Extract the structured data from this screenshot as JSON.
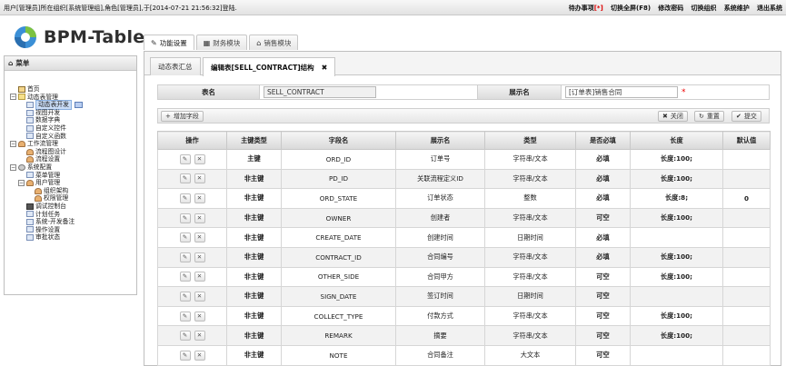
{
  "topbar": {
    "login_text": "用户[管理员]所在组织[系统管理组],角色[管理员],于[2014-07-21 21:56:32]登陆.",
    "todo_label": "待办事项",
    "todo_count_bracket": "[*]",
    "links": [
      "切换全屏(F8)",
      "修改密码",
      "切换组织",
      "系统维护",
      "退出系统"
    ]
  },
  "logo": {
    "text": "BPM-Table"
  },
  "module_tabs": [
    {
      "icon": "wrench-icon",
      "label": "功能设置",
      "active": true
    },
    {
      "icon": "grid-icon",
      "label": "财务模块",
      "active": false
    },
    {
      "icon": "home-icon",
      "label": "销售模块",
      "active": false
    }
  ],
  "sidebar": {
    "title": "菜单",
    "tree": [
      {
        "label": "首页",
        "level": 0,
        "icon": "home",
        "toggle": ""
      },
      {
        "label": "动态表管理",
        "level": 0,
        "icon": "folder",
        "toggle": "−"
      },
      {
        "label": "动态表开发",
        "level": 1,
        "icon": "doc",
        "toggle": "",
        "selected": true
      },
      {
        "label": "视图开发",
        "level": 1,
        "icon": "doc",
        "toggle": ""
      },
      {
        "label": "数据字典",
        "level": 1,
        "icon": "doc",
        "toggle": ""
      },
      {
        "label": "自定义控件",
        "level": 1,
        "icon": "doc",
        "toggle": ""
      },
      {
        "label": "自定义函数",
        "level": 1,
        "icon": "doc",
        "toggle": ""
      },
      {
        "label": "工作流管理",
        "level": 0,
        "icon": "people",
        "toggle": "−"
      },
      {
        "label": "流程图设计",
        "level": 1,
        "icon": "people",
        "toggle": ""
      },
      {
        "label": "流程设置",
        "level": 1,
        "icon": "people",
        "toggle": ""
      },
      {
        "label": "系统配置",
        "level": 0,
        "icon": "gear",
        "toggle": "−"
      },
      {
        "label": "菜单管理",
        "level": 1,
        "icon": "doc",
        "toggle": ""
      },
      {
        "label": "用户管理",
        "level": 1,
        "icon": "people",
        "toggle": "−"
      },
      {
        "label": "组织架构",
        "level": 2,
        "icon": "people",
        "toggle": ""
      },
      {
        "label": "权限管理",
        "level": 2,
        "icon": "people",
        "toggle": ""
      },
      {
        "label": "调试控制台",
        "level": 1,
        "icon": "dark",
        "toggle": ""
      },
      {
        "label": "计划任务",
        "level": 1,
        "icon": "doc",
        "toggle": ""
      },
      {
        "label": "系统-开发备注",
        "level": 1,
        "icon": "doc",
        "toggle": ""
      },
      {
        "label": "操作设置",
        "level": 1,
        "icon": "doc",
        "toggle": ""
      },
      {
        "label": "审批状态",
        "level": 1,
        "icon": "doc",
        "toggle": ""
      }
    ]
  },
  "content_tabs": [
    {
      "label": "动态表汇总",
      "active": false,
      "closable": false
    },
    {
      "label": "编辑表[SELL_CONTRACT]结构",
      "active": true,
      "closable": true,
      "close_glyph": "✖"
    }
  ],
  "form": {
    "table_name_label": "表名",
    "table_name_value": "SELL_CONTRACT",
    "display_name_label": "展示名",
    "display_name_value": "[订单表]销售合同",
    "required_mark": "*"
  },
  "toolbar": {
    "add_field": "增加字段",
    "close": "关闭",
    "reset": "重置",
    "submit": "提交"
  },
  "grid": {
    "columns": [
      "操作",
      "主键类型",
      "字段名",
      "展示名",
      "类型",
      "是否必填",
      "长度",
      "默认值"
    ],
    "rows": [
      [
        "主键",
        "ORD_ID",
        "订单号",
        "字符串/文本",
        "必填",
        "长度:100;",
        ""
      ],
      [
        "非主键",
        "PD_ID",
        "关联流程定义ID",
        "字符串/文本",
        "必填",
        "长度:100;",
        ""
      ],
      [
        "非主键",
        "ORD_STATE",
        "订单状态",
        "整数",
        "必填",
        "长度:8;",
        "0"
      ],
      [
        "非主键",
        "OWNER",
        "创建者",
        "字符串/文本",
        "可空",
        "长度:100;",
        ""
      ],
      [
        "非主键",
        "CREATE_DATE",
        "创建时间",
        "日期时间",
        "必填",
        "",
        ""
      ],
      [
        "非主键",
        "CONTRACT_ID",
        "合同编号",
        "字符串/文本",
        "必填",
        "长度:100;",
        ""
      ],
      [
        "非主键",
        "OTHER_SIDE",
        "合同甲方",
        "字符串/文本",
        "可空",
        "长度:100;",
        ""
      ],
      [
        "非主键",
        "SIGN_DATE",
        "签订时间",
        "日期时间",
        "可空",
        "",
        ""
      ],
      [
        "非主键",
        "COLLECT_TYPE",
        "付款方式",
        "字符串/文本",
        "可空",
        "长度:100;",
        ""
      ],
      [
        "非主键",
        "REMARK",
        "摘要",
        "字符串/文本",
        "可空",
        "长度:100;",
        ""
      ],
      [
        "非主键",
        "NOTE",
        "合同备注",
        "大文本",
        "可空",
        "",
        ""
      ]
    ]
  }
}
